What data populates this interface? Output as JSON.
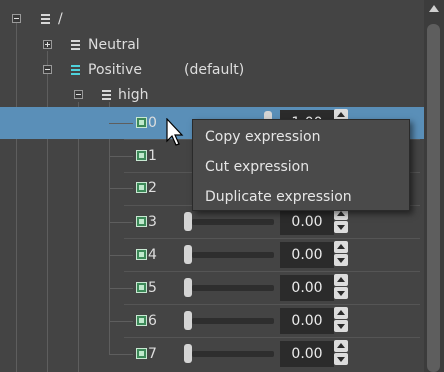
{
  "tree": {
    "root": {
      "label": "/"
    },
    "neutral": {
      "label": "Neutral"
    },
    "positive": {
      "label": "Positive",
      "tag": "(default)"
    },
    "high": {
      "label": "high"
    }
  },
  "rows": [
    {
      "label": "0",
      "value": "1.00",
      "selected": true
    },
    {
      "label": "1",
      "value": "",
      "selected": false
    },
    {
      "label": "2",
      "value": "",
      "selected": false
    },
    {
      "label": "3",
      "value": "0.00",
      "selected": false
    },
    {
      "label": "4",
      "value": "0.00",
      "selected": false
    },
    {
      "label": "5",
      "value": "0.00",
      "selected": false
    },
    {
      "label": "6",
      "value": "0.00",
      "selected": false
    },
    {
      "label": "7",
      "value": "0.00",
      "selected": false
    }
  ],
  "context_menu": {
    "items": [
      "Copy expression",
      "Cut expression",
      "Duplicate expression"
    ]
  },
  "colors": {
    "background": "#444444",
    "selection": "#5a8fb8",
    "accent_icon": "#4fd2dc",
    "expression_icon": "#3d8a59"
  }
}
